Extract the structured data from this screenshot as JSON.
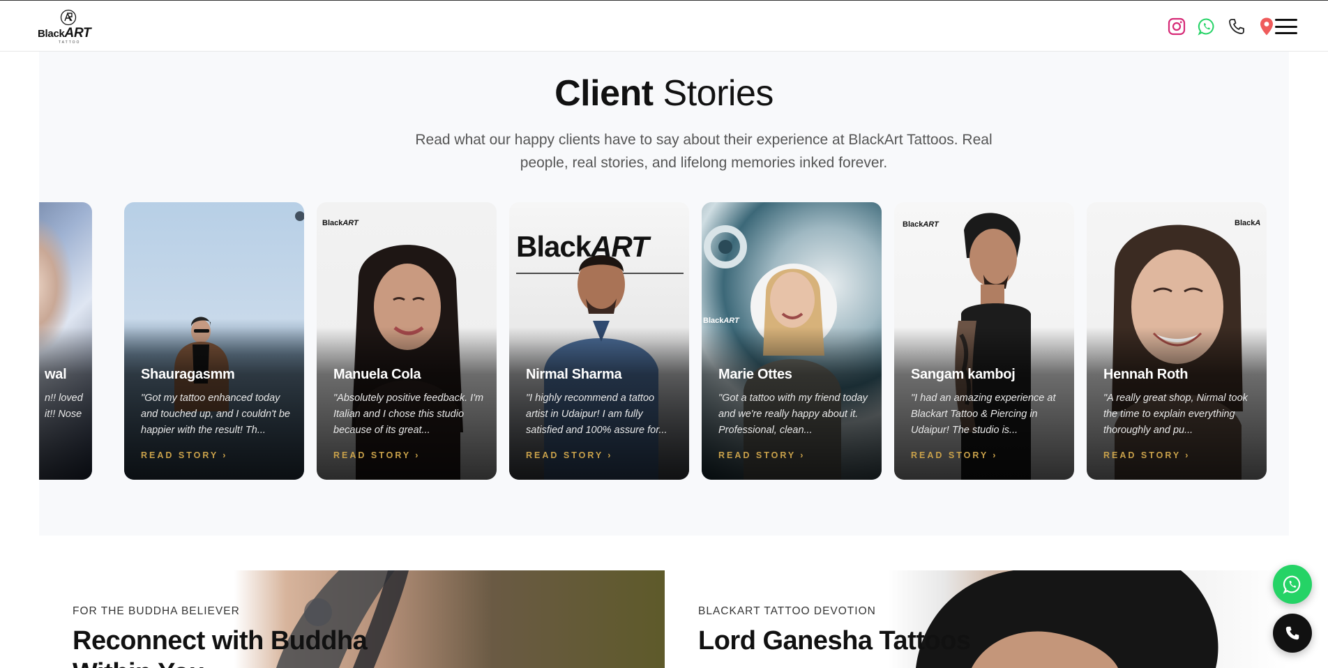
{
  "header": {
    "logo_text_main": "Black",
    "logo_text_accent": "ART",
    "logo_sub": "TATTOO",
    "icons": [
      "instagram-icon",
      "whatsapp-icon",
      "phone-icon",
      "location-pin-icon",
      "menu-icon"
    ]
  },
  "stories": {
    "title_bold": "Client",
    "title_rest": "Stories",
    "description": "Read what our happy clients have to say about their experience at BlackArt Tattoos. Real people, real stories, and lifelong memories inked forever.",
    "read_label": "READ STORY",
    "cards": [
      {
        "name": "wal",
        "quote": "n!! loved it!! Nose"
      },
      {
        "name": "Shauragasmm",
        "quote": "\"Got my tattoo enhanced today and touched up, and I couldn't be happier with the result! Th..."
      },
      {
        "name": "Manuela Cola",
        "quote": "\"Absolutely positive feedback. I'm Italian and I chose this studio because of its great..."
      },
      {
        "name": "Nirmal Sharma",
        "quote": "\"I highly recommend a tattoo artist in Udaipur! I am fully satisfied and 100% assure for..."
      },
      {
        "name": "Marie Ottes",
        "quote": "\"Got a tattoo with my friend today and we're really happy about it. Professional, clean..."
      },
      {
        "name": "Sangam kamboj",
        "quote": "\"I had an amazing experience at Blackart Tattoo & Piercing in Udaipur! The studio is..."
      },
      {
        "name": "Hennah Roth",
        "quote": "\"A really great shop, Nirmal took the time to explain everything thoroughly and pu..."
      }
    ]
  },
  "features": [
    {
      "eyebrow": "FOR THE BUDDHA BELIEVER",
      "title": "Reconnect with Buddha Within You"
    },
    {
      "eyebrow": "BLACKART TATTOO DEVOTION",
      "title": "Lord Ganesha Tattoos"
    }
  ],
  "colors": {
    "accent_gold": "#c9a14a",
    "whatsapp_green": "#25d366",
    "instagram_pink": "#d62976",
    "location_red": "#ef5b5b",
    "section_bg": "#f8f9fb"
  }
}
